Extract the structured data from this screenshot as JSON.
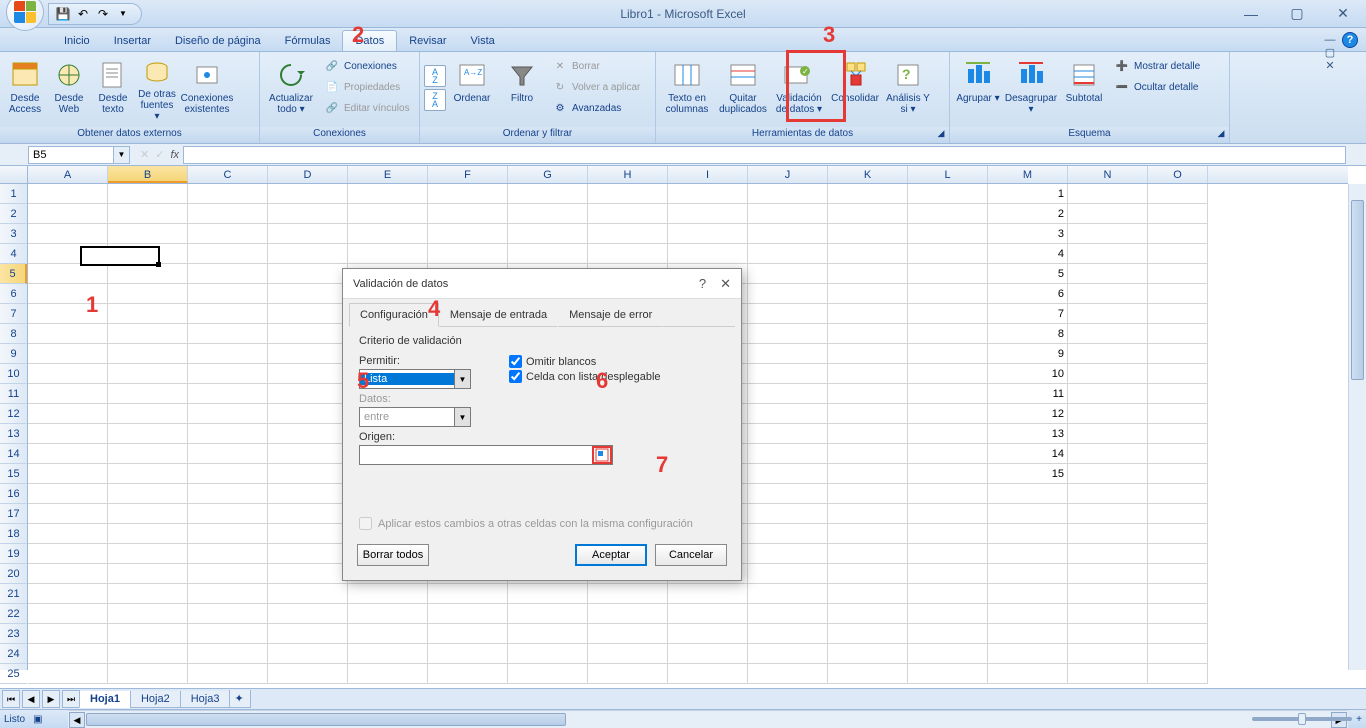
{
  "app": {
    "title": "Libro1 - Microsoft Excel"
  },
  "qat": {
    "save": "💾",
    "undo": "↶",
    "redo": "↷"
  },
  "tabs": [
    "Inicio",
    "Insertar",
    "Diseño de página",
    "Fórmulas",
    "Datos",
    "Revisar",
    "Vista"
  ],
  "active_tab": "Datos",
  "ribbon": {
    "externos": {
      "title": "Obtener datos externos",
      "access": "Desde Access",
      "web": "Desde Web",
      "texto": "Desde texto",
      "otras": "De otras fuentes ▾",
      "existentes": "Conexiones existentes"
    },
    "conex": {
      "title": "Conexiones",
      "actualizar": "Actualizar todo ▾",
      "conexiones": "Conexiones",
      "propiedades": "Propiedades",
      "editar": "Editar vínculos"
    },
    "ordenar": {
      "title": "Ordenar y filtrar",
      "ordenar": "Ordenar",
      "filtro": "Filtro",
      "borrar": "Borrar",
      "volver": "Volver a aplicar",
      "avanz": "Avanzadas"
    },
    "herram": {
      "title": "Herramientas de datos",
      "texto": "Texto en columnas",
      "quitar": "Quitar duplicados",
      "validacion": "Validación de datos ▾",
      "consolidar": "Consolidar",
      "analisis": "Análisis Y si ▾"
    },
    "esquema": {
      "title": "Esquema",
      "agrupar": "Agrupar ▾",
      "desagrupar": "Desagrupar ▾",
      "subtotal": "Subtotal",
      "mostrar": "Mostrar detalle",
      "ocultar": "Ocultar detalle"
    }
  },
  "namebox": "B5",
  "columns": [
    "A",
    "B",
    "C",
    "D",
    "E",
    "F",
    "G",
    "H",
    "I",
    "J",
    "K",
    "L",
    "M",
    "N",
    "O"
  ],
  "col_data": {
    "M": [
      1,
      2,
      3,
      4,
      5,
      6,
      7,
      8,
      9,
      10,
      11,
      12,
      13,
      14,
      15
    ]
  },
  "sheets": [
    "Hoja1",
    "Hoja2",
    "Hoja3"
  ],
  "active_sheet": "Hoja1",
  "status": {
    "ready": "Listo",
    "zoom": "100%"
  },
  "dialog": {
    "title": "Validación de datos",
    "tabs": [
      "Configuración",
      "Mensaje de entrada",
      "Mensaje de error"
    ],
    "criterio": "Criterio de validación",
    "permitir_label": "Permitir:",
    "permitir_value": "Lista",
    "datos_label": "Datos:",
    "datos_value": "entre",
    "omitir": "Omitir blancos",
    "celda": "Celda con lista desplegable",
    "origen": "Origen:",
    "aplicar": "Aplicar estos cambios a otras celdas con la misma configuración",
    "borrar": "Borrar todos",
    "aceptar": "Aceptar",
    "cancelar": "Cancelar"
  },
  "annotations": {
    "a1": "1",
    "a2": "2",
    "a3": "3",
    "a4": "4",
    "a5": "5",
    "a6": "6",
    "a7": "7"
  }
}
